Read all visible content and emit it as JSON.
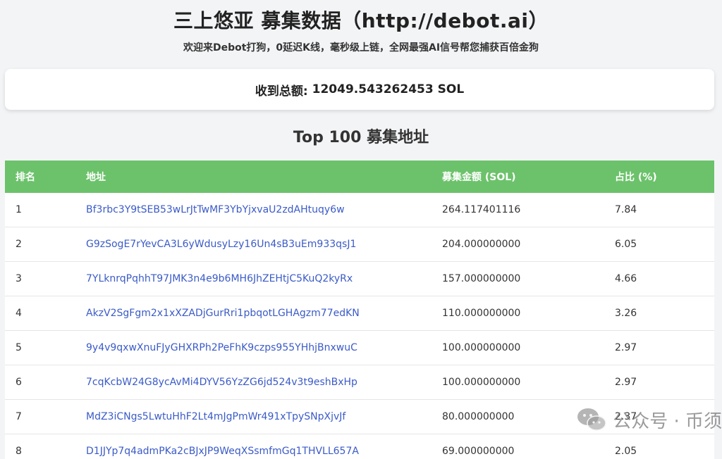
{
  "header": {
    "title": "三上悠亚 募集数据（http://debot.ai）",
    "subtitle": "欢迎来Debot打狗，0延迟K线，毫秒级上链，全网最强AI信号帮您捕获百倍金狗"
  },
  "summary": {
    "label": "收到总额:",
    "value": "12049.543262453 SOL"
  },
  "section": {
    "title": "Top 100 募集地址"
  },
  "table": {
    "columns": [
      "排名",
      "地址",
      "募集金额 (SOL)",
      "占比 (%)"
    ],
    "rows": [
      {
        "rank": "1",
        "address": "Bf3rbc3Y9tSEB53wLrJtTwMF3YbYjxvaU2zdAHtuqy6w",
        "amount": "264.117401116",
        "percent": "7.84"
      },
      {
        "rank": "2",
        "address": "G9zSogE7rYevCA3L6yWdusyLzy16Un4sB3uEm933qsJ1",
        "amount": "204.000000000",
        "percent": "6.05"
      },
      {
        "rank": "3",
        "address": "7YLknrqPqhhT97JMK3n4e9b6MH6JhZEHtjC5KuQ2kyRx",
        "amount": "157.000000000",
        "percent": "4.66"
      },
      {
        "rank": "4",
        "address": "AkzV2SgFgm2x1xXZADjGurRri1pbqotLGHAgzm77edKN",
        "amount": "110.000000000",
        "percent": "3.26"
      },
      {
        "rank": "5",
        "address": "9y4v9qxwXnuFJyGHXRPh2PeFhK9czps955YHhjBnxwuC",
        "amount": "100.000000000",
        "percent": "2.97"
      },
      {
        "rank": "6",
        "address": "7cqKcbW24G8ycAvMi4DYV56YzZG6jd524v3t9eshBxHp",
        "amount": "100.000000000",
        "percent": "2.97"
      },
      {
        "rank": "7",
        "address": "MdZ3iCNgs5LwtuHhF2Lt4mJgPmWr491xTpySNpXjvJf",
        "amount": "80.000000000",
        "percent": "2.37"
      },
      {
        "rank": "8",
        "address": "D1JJYp7q4admPKa2cBJxJP9WeqXSsmfmGq1THVLL657A",
        "amount": "69.000000000",
        "percent": "2.05"
      }
    ]
  },
  "watermark": {
    "text": "公众号 · 币须"
  },
  "colors": {
    "header_green": "#6cc26b",
    "link_blue": "#3b5bc7"
  }
}
